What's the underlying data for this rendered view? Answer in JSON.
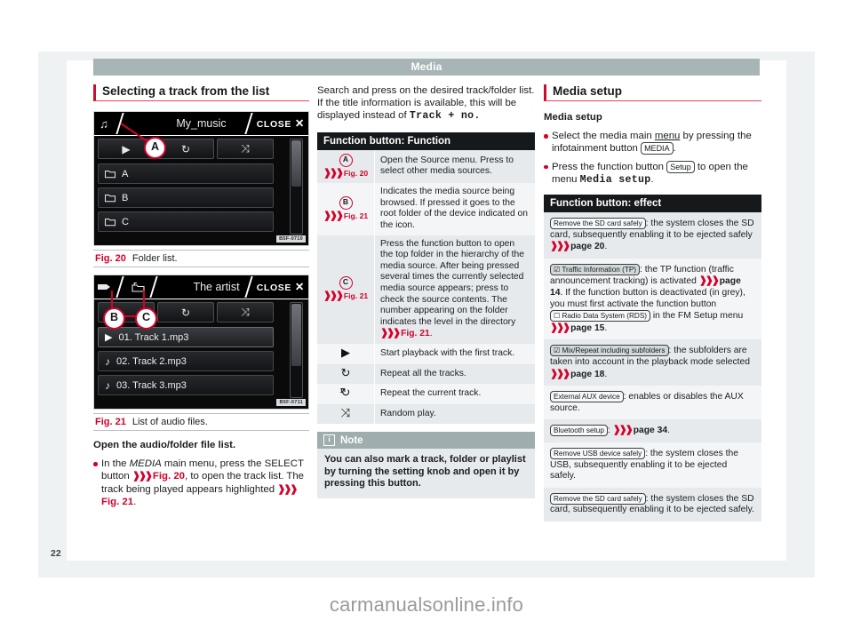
{
  "page": {
    "running_head": "Media",
    "folio": "22",
    "watermark": "carmanualsonline.info"
  },
  "col1": {
    "section_title": "Selecting a track from the list",
    "fig20": {
      "title": "My_music",
      "close_label": "CLOSE",
      "close_icon": "✕",
      "tab_icon": "♫",
      "buttons": [
        "▶",
        "↻",
        "⤨"
      ],
      "rows": [
        {
          "icon": "folder",
          "label": "A"
        },
        {
          "icon": "folder",
          "label": "B"
        },
        {
          "icon": "folder",
          "label": "C"
        }
      ],
      "code": "B5F-0710",
      "callouts": [
        "A"
      ],
      "caption_num": "Fig. 20",
      "caption_text": "Folder list."
    },
    "fig21": {
      "title": "The artist",
      "close_label": "CLOSE",
      "close_icon": "✕",
      "tab_icon_b": "sd-card",
      "tab_icon_c": "folder-up",
      "buttons": [
        "↻",
        "⤨"
      ],
      "rows": [
        {
          "icon": "play",
          "label": "01. Track 1.mp3"
        },
        {
          "icon": "note",
          "label": "02. Track 2.mp3"
        },
        {
          "icon": "note",
          "label": "03. Track 3.mp3"
        }
      ],
      "code": "B5F-0711",
      "callouts": [
        "B",
        "C"
      ],
      "caption_num": "Fig. 21",
      "caption_text": "List of audio files."
    },
    "subhead": "Open the audio/folder file list.",
    "bullet": {
      "t1": "In the ",
      "italic": "MEDIA",
      "t2": " main menu, press the SELECT button ",
      "ref1": "Fig. 20",
      "t3": ", to open the track list. The track being played appears highlighted ",
      "ref2": "Fig. 21",
      "t4": "."
    }
  },
  "col2": {
    "intro": {
      "t1": "Search and press on the desired track/folder list. If the title information is available, this will be displayed instead of ",
      "mono": "Track + no."
    },
    "table": {
      "header": "Function button: Function",
      "rows": [
        {
          "key": "A",
          "key_ref": "Fig. 20",
          "text": "Open the Source menu. Press to select other media sources."
        },
        {
          "key": "B",
          "key_ref": "Fig. 21",
          "text": "Indicates the media source being browsed. If pressed it goes to the root folder of the device indicated on the icon."
        },
        {
          "key": "C",
          "key_ref": "Fig. 21",
          "text": "Press the function button to open the top folder in the hierarchy of the media source. After being pressed several times the currently selected media source appears; press to check the source contents. The number appearing on the folder indicates the level in the directory ",
          "text_ref": "Fig. 21",
          "text_end": "."
        },
        {
          "glyph": "play-icon",
          "glyph_char": "▶",
          "text": "Start playback with the first track."
        },
        {
          "glyph": "repeat-all-icon",
          "glyph_char": "↻",
          "text": "Repeat all the tracks."
        },
        {
          "glyph": "repeat-one-icon",
          "glyph_char": "↻",
          "text": "Repeat the current track."
        },
        {
          "glyph": "shuffle-icon",
          "glyph_char": "⤨",
          "text": "Random play."
        }
      ]
    },
    "note": {
      "title": "Note",
      "icon": "i",
      "body": "You can also mark a track, folder or playlist by turning the setting knob and open it by pressing this button."
    }
  },
  "col3": {
    "section_title": "Media setup",
    "subhead": "Media setup",
    "bullets": [
      {
        "t1": "Select the media main ",
        "underlined": "menu",
        "t2": " by pressing the infotainment button ",
        "chip": "MEDIA",
        "t3": "."
      },
      {
        "t1": "Press the function button ",
        "chip": "Setup",
        "t2": " to open the menu ",
        "mono": "Media setup",
        "t3": "."
      }
    ],
    "table": {
      "header": "Function button: effect",
      "rows": [
        {
          "chip": "Remove the SD card safely",
          "chip_checked": false,
          "t1": ": the system closes the SD card, subsequently enabling it to be ejected safely ",
          "ref": "page 20",
          "t2": "."
        },
        {
          "chip": "Traffic Information (TP)",
          "chip_checked": true,
          "t1": ": the TP function (traffic announcement tracking) is activated ",
          "ref": "page 14",
          "t2": ". If the function button is deactivated (in grey), you must first activate the function button ",
          "chip2": "Radio Data System (RDS)",
          "chip2_checked": false,
          "chip2_box": true,
          "t3": " in the FM Setup menu ",
          "ref2": "page 15",
          "t4": "."
        },
        {
          "chip": "Mix/Repeat including subfolders",
          "chip_checked": true,
          "t1": ": the subfolders are taken into account in the playback mode selected ",
          "ref": "page 18",
          "t2": "."
        },
        {
          "chip": "External AUX device",
          "chip_checked": false,
          "t1": ": enables or disables the AUX source."
        },
        {
          "chip": "Bluetooth setup",
          "chip_checked": false,
          "t1": ": ",
          "ref": "page 34",
          "t2": "."
        },
        {
          "chip": "Remove USB device safely",
          "chip_checked": false,
          "t1": ": the system closes the USB, subsequently enabling it to be ejected safely."
        },
        {
          "chip": "Remove the SD card safely",
          "chip_checked": false,
          "t1": ": the system closes the SD card, subsequently enabling it to be ejected safely."
        }
      ]
    }
  }
}
